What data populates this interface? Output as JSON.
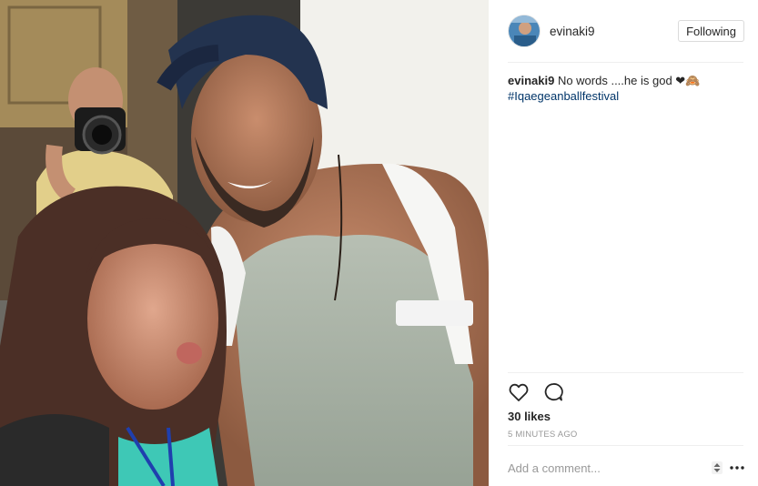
{
  "post": {
    "username": "evinaki9",
    "follow_label": "Following",
    "caption_user": "evinaki9",
    "caption_text": " No words ....he is god ❤🙈",
    "hashtag": "#Iqaegeanballfestival",
    "likes": "30 likes",
    "time": "5 MINUTES AGO",
    "comment_placeholder": "Add a comment..."
  },
  "icons": {
    "like": "heart-icon",
    "comment": "comment-icon",
    "sort": "up-down-arrows-icon",
    "more": "more-options-icon"
  },
  "colors": {
    "hashtag": "#003569",
    "border": "#dbdbdb"
  }
}
